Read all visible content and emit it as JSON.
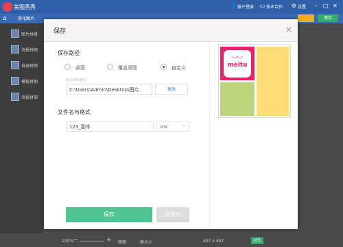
{
  "app": {
    "title": "美图秀秀"
  },
  "titlebar": {
    "account": "帐户登录",
    "cooperation": "技术合作",
    "settings": "设置"
  },
  "tabs": {
    "first": "美化图片",
    "open_label": "",
    "save_label": "保存"
  },
  "sidebar": {
    "items": [
      {
        "label": "图片拼接"
      },
      {
        "label": "海报拼图"
      },
      {
        "label": "自由拼图"
      },
      {
        "label": "模板拼图"
      },
      {
        "label": "海报拼图"
      }
    ]
  },
  "statusbar": {
    "zoom": "100%",
    "fit": "原图",
    "actual": "原大小",
    "size": "497 x 497",
    "compare": "对比"
  },
  "dialog": {
    "title": "保存",
    "path_section": "保存路径",
    "radio_options": [
      {
        "label": "桌面",
        "checked": false
      },
      {
        "label": "覆盖原图",
        "checked": false
      },
      {
        "label": "自定义",
        "checked": true
      }
    ],
    "path_hint": "默认保存路径",
    "path_value": "C:\\Users\\Admin\\Desktop\\图片",
    "change_label": "更改",
    "name_section": "文件名与格式",
    "filename_value": "123_副本",
    "format_value": "png",
    "save_label": "保存",
    "save_as_label": "另存为"
  },
  "preview": {
    "logo_text": "meitu"
  },
  "colors": {
    "accent": "#4fc492",
    "titlebar": "#2f5fa8",
    "brand_pink": "#e8236a"
  }
}
